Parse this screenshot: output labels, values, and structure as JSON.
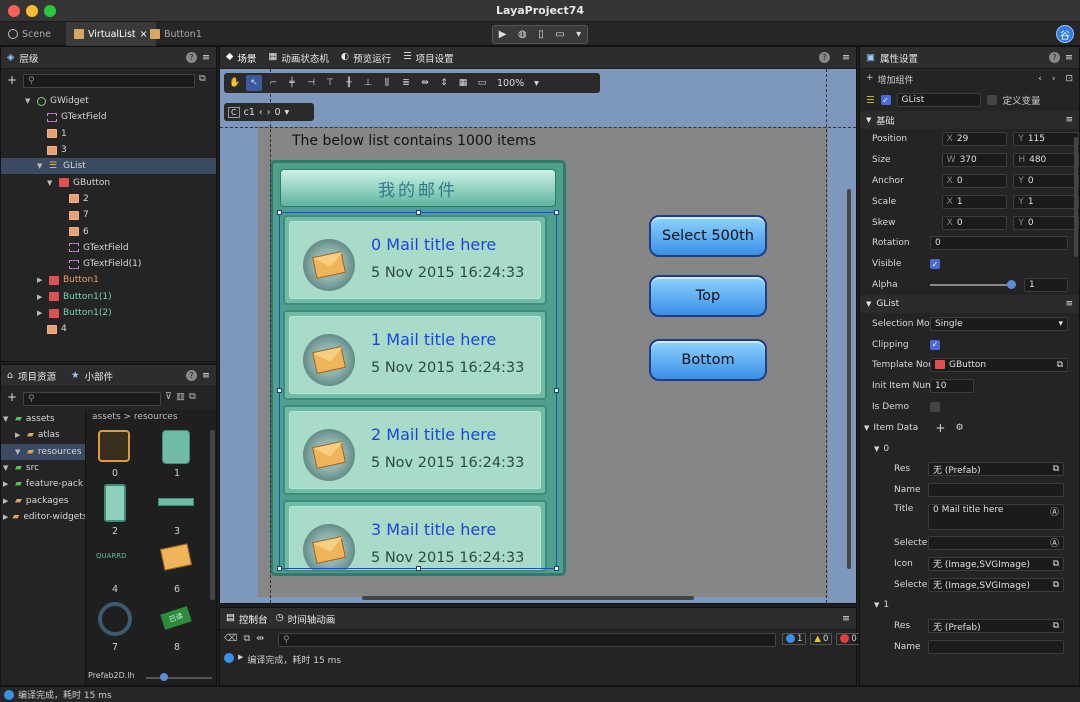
{
  "window": {
    "title": "LayaProject74"
  },
  "doc_tabs": [
    {
      "label": "Scene"
    },
    {
      "label": "VirtualList",
      "close": "×"
    },
    {
      "label": "Button1"
    }
  ],
  "user": {
    "avatar": "谷"
  },
  "hierarchy": {
    "title": "层级",
    "search_placeholder": "",
    "tree": [
      {
        "label": "GWidget",
        "icon": "widget"
      },
      {
        "label": "GTextField",
        "icon": "text"
      },
      {
        "label": "1",
        "icon": "image"
      },
      {
        "label": "3",
        "icon": "image"
      },
      {
        "label": "GList",
        "icon": "list"
      },
      {
        "label": "GButton",
        "icon": "button"
      },
      {
        "label": "2",
        "icon": "image"
      },
      {
        "label": "7",
        "icon": "image"
      },
      {
        "label": "6",
        "icon": "image"
      },
      {
        "label": "GTextField",
        "icon": "text"
      },
      {
        "label": "GTextField(1)",
        "icon": "text"
      },
      {
        "label": "Button1",
        "icon": "button"
      },
      {
        "label": "Button1(1)",
        "icon": "button"
      },
      {
        "label": "Button1(2)",
        "icon": "button"
      },
      {
        "label": "4",
        "icon": "image"
      }
    ]
  },
  "assets": {
    "tab_project": "项目资源",
    "tab_widgets": "小部件",
    "tree": [
      {
        "label": "assets"
      },
      {
        "label": "atlas"
      },
      {
        "label": "resources"
      },
      {
        "label": "src"
      },
      {
        "label": "feature-pack"
      },
      {
        "label": "packages"
      },
      {
        "label": "editor-widgets"
      }
    ],
    "breadcrumb": "assets > resources",
    "grid": [
      {
        "label": "0"
      },
      {
        "label": "1"
      },
      {
        "label": "2"
      },
      {
        "label": "3"
      },
      {
        "label": "4"
      },
      {
        "label": "6"
      },
      {
        "label": "7"
      },
      {
        "label": "8"
      }
    ],
    "bottom_file": "Prefab2D.lh",
    "thumb_text": "QUARRD",
    "thumb_stamp": "已读"
  },
  "editor_tabs": [
    {
      "label": "场景"
    },
    {
      "label": "动画状态机"
    },
    {
      "label": "预览运行"
    },
    {
      "label": "项目设置"
    }
  ],
  "toolbar": {
    "zoom": "100%",
    "controller": "c1",
    "page": "0",
    "ctrl_icon": "C"
  },
  "scene": {
    "caption": "The below list contains 1000 items",
    "header_text": "我的邮件",
    "items": [
      {
        "title": "0 Mail title here",
        "date": "5 Nov 2015 16:24:33"
      },
      {
        "title": "1 Mail title here",
        "date": "5 Nov 2015 16:24:33"
      },
      {
        "title": "2 Mail title here",
        "date": "5 Nov 2015 16:24:33"
      },
      {
        "title": "3 Mail title here",
        "date": "5 Nov 2015 16:24:33"
      }
    ],
    "buttons": [
      {
        "label": "Select 500th"
      },
      {
        "label": "Top"
      },
      {
        "label": "Bottom"
      }
    ]
  },
  "console": {
    "tab_console": "控制台",
    "tab_timeline": "时间轴动画",
    "badges": {
      "info": "1",
      "warn": "0",
      "error": "0"
    },
    "log": "编译完成，耗时 15 ms"
  },
  "status_bar": {
    "text": "编译完成，耗时 15 ms"
  },
  "inspector": {
    "title": "属性设置",
    "add_component": "增加组件",
    "node_name": "GList",
    "custom_var_label": "定义变量",
    "section_basic": "基础",
    "position_label": "Position",
    "x": "29",
    "y": "115",
    "size_label": "Size",
    "w": "370",
    "h": "480",
    "anchor_label": "Anchor",
    "anchor_x": "0",
    "anchor_y": "0",
    "scale_label": "Scale",
    "scale_x": "1",
    "scale_y": "1",
    "skew_label": "Skew",
    "skew_x": "0",
    "skew_y": "0",
    "rotation_label": "Rotation",
    "rotation": "0",
    "visible_label": "Visible",
    "alpha_label": "Alpha",
    "alpha": "1",
    "section_glist": "GList",
    "selection_mode_label": "Selection Mo",
    "selection_mode": "Single",
    "clipping_label": "Clipping",
    "template_label": "Template Noc",
    "template": "GButton",
    "init_num_label": "Init Item Num",
    "init_num": "10",
    "is_demo_label": "Is Demo",
    "item_data_label": "Item Data",
    "items": [
      {
        "index": "0",
        "res_label": "Res",
        "res": "无 (Prefab)",
        "name_label": "Name",
        "title_label": "Title",
        "title": "0 Mail title here",
        "selected_title_label": "Selecte",
        "icon_label": "Icon",
        "icon": "无 (Image,SVGImage)",
        "selected_icon_label": "Selecte",
        "selected_icon": "无 (Image,SVGImage)"
      },
      {
        "index": "1",
        "res_label": "Res",
        "res": "无 (Prefab)",
        "name_label": "Name"
      }
    ],
    "x_lbl": "X",
    "y_lbl": "Y",
    "w_lbl": "W",
    "h_lbl": "H"
  },
  "colors": {
    "accent": "#4b6ad8",
    "selection": "#3b4a63",
    "title_blue": "#1e44e0"
  }
}
